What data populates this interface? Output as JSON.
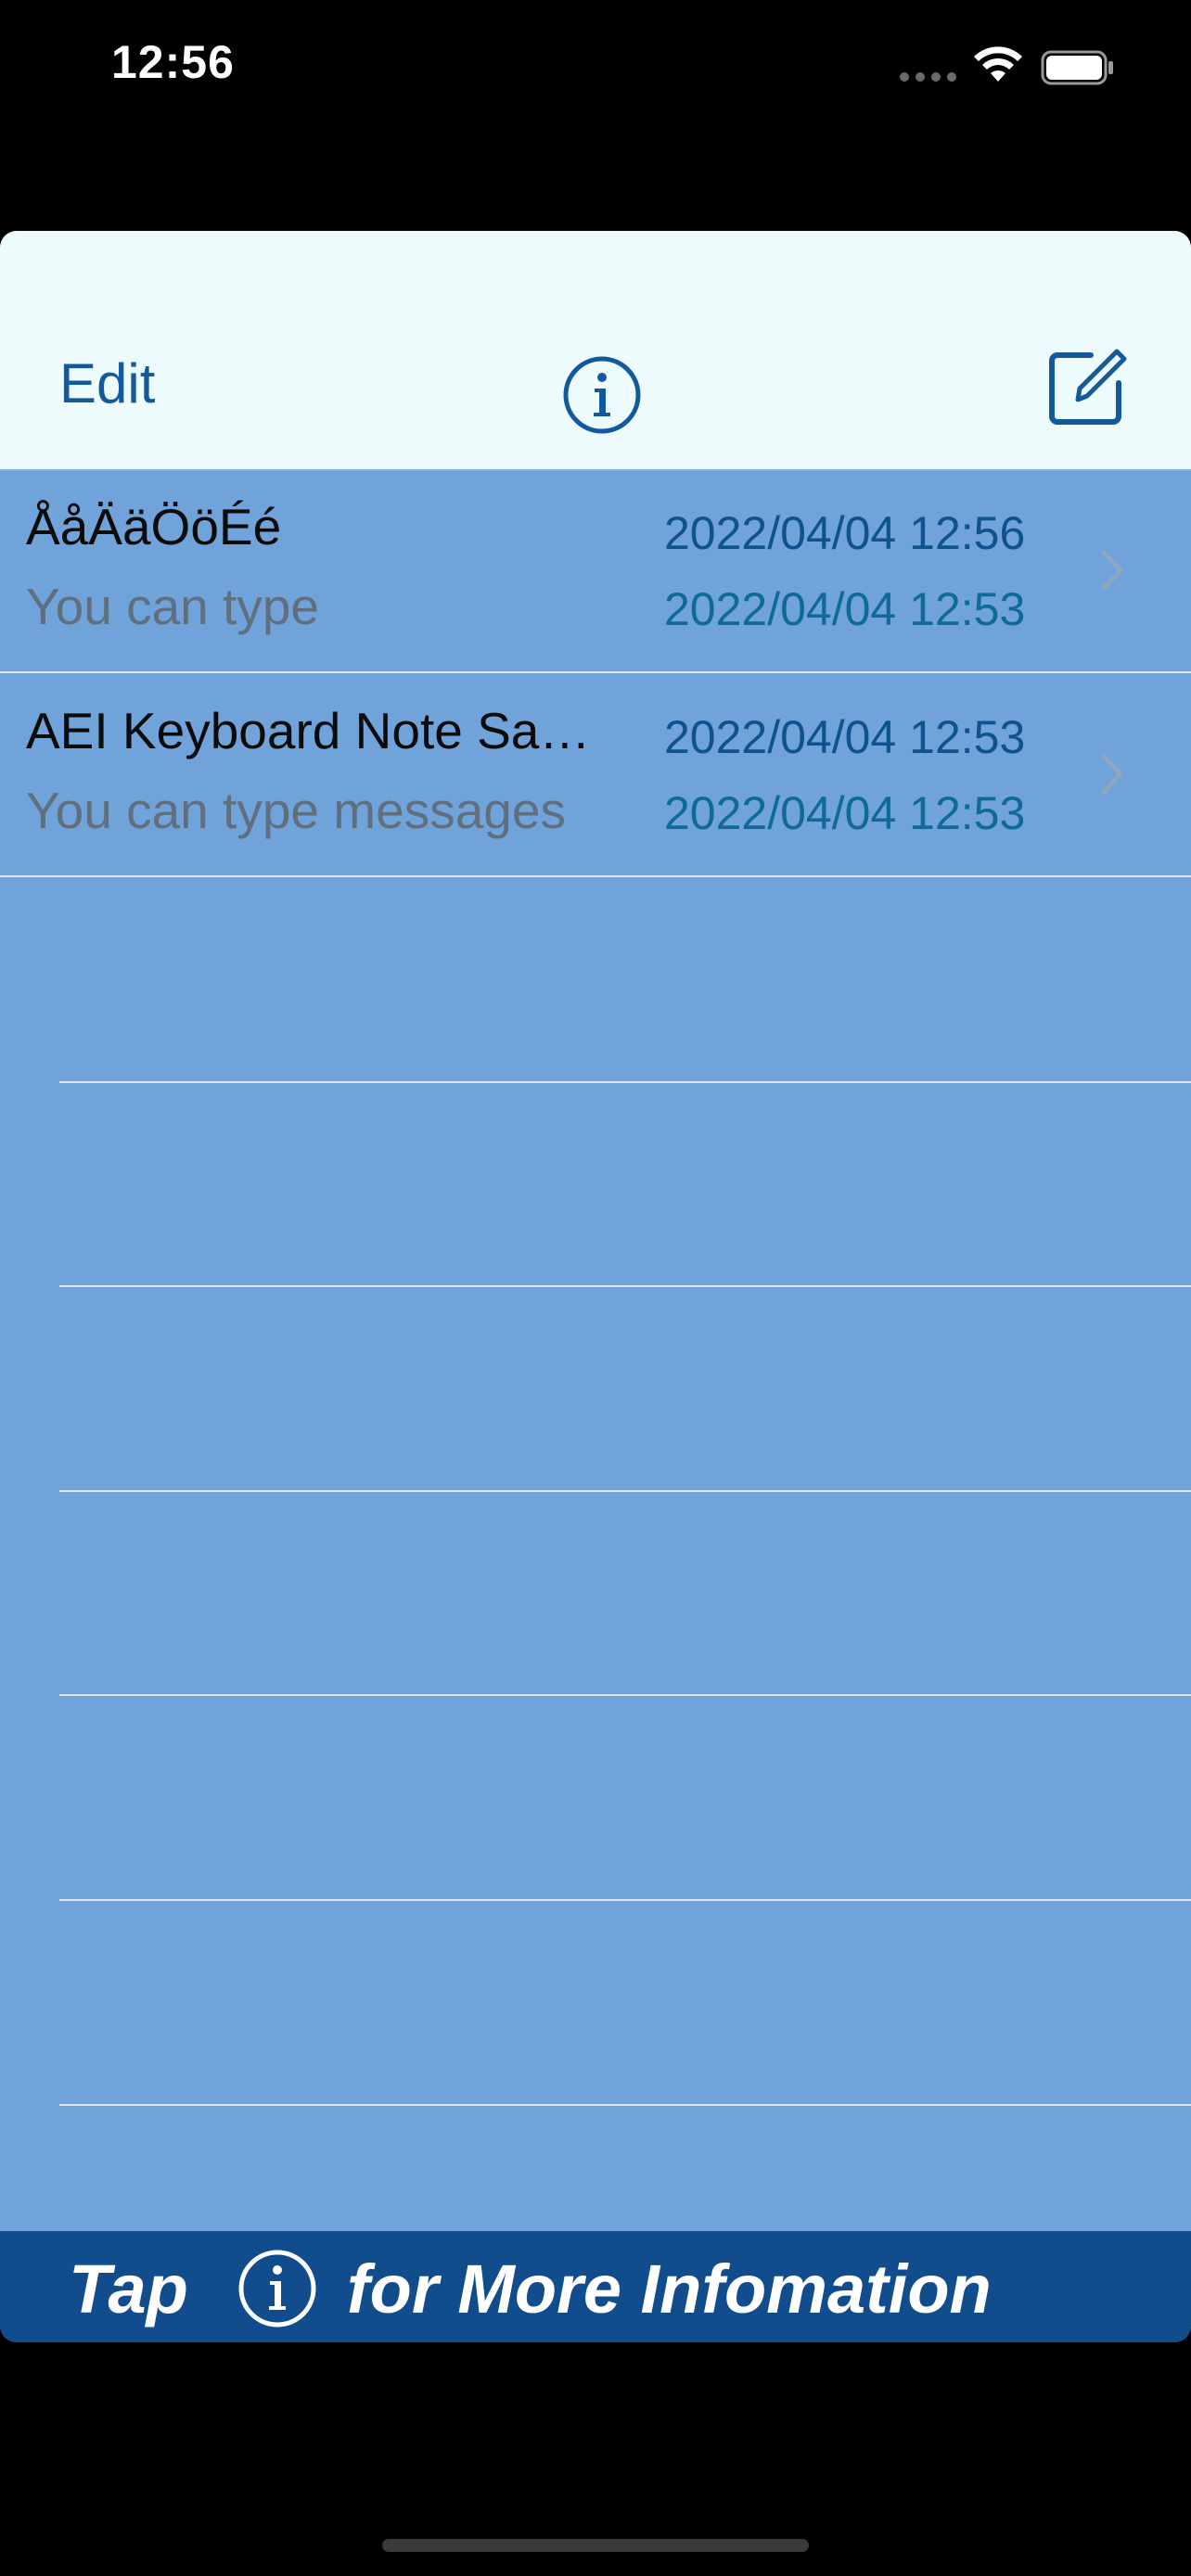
{
  "status_bar": {
    "time": "12:56"
  },
  "nav": {
    "edit_label": "Edit"
  },
  "notes": [
    {
      "title": "ÅåÄäÖöÉé",
      "subtitle": "You can type",
      "date_modified": "2022/04/04 12:56",
      "date_created": "2022/04/04 12:53"
    },
    {
      "title": "AEI Keyboard Note Sample",
      "subtitle": "You can type messages",
      "date_modified": "2022/04/04 12:53",
      "date_created": "2022/04/04 12:53"
    }
  ],
  "banner": {
    "text_before": "Tap",
    "text_after": "for More Infomation"
  },
  "colors": {
    "accent": "#135a9c",
    "nav_background": "#eefbfd",
    "list_background": "#6fa3d9",
    "banner_background": "#114c8c"
  }
}
